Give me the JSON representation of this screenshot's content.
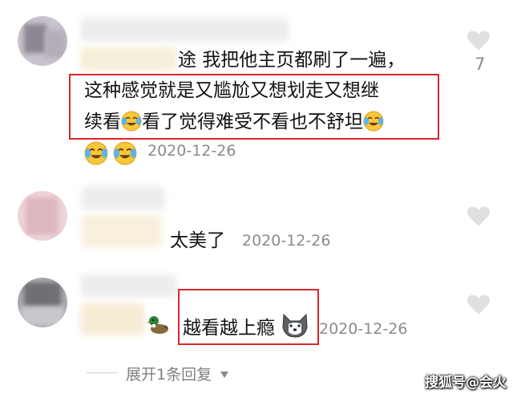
{
  "comments": [
    {
      "line1": "途 我把他主页都刷了一遍，",
      "line2": "这种感觉就是又尴尬又想划走又想继",
      "line3_a": "续看",
      "line3_b": "看了觉得难受不看也不舒坦",
      "emoji_names": [
        "tears-of-joy-emoji",
        "tears-of-joy-emoji",
        "tears-of-joy-emoji",
        "tears-of-joy-emoji"
      ],
      "date": "2020-12-26",
      "likes": "7"
    },
    {
      "text": "太美了",
      "date": "2020-12-26"
    },
    {
      "text": "越看越上瘾",
      "emoji_names": [
        "duck-emoji",
        "husky-dog-emoji"
      ],
      "date": "2020-12-26"
    }
  ],
  "expand_replies": {
    "label": "展开1条回复",
    "icon": "caret-down-icon"
  },
  "watermark": "搜狐号@会火",
  "colors": {
    "highlight_border": "#d9262b",
    "date_text": "#8b8b8b",
    "like_heart": "#e0e0e0"
  }
}
